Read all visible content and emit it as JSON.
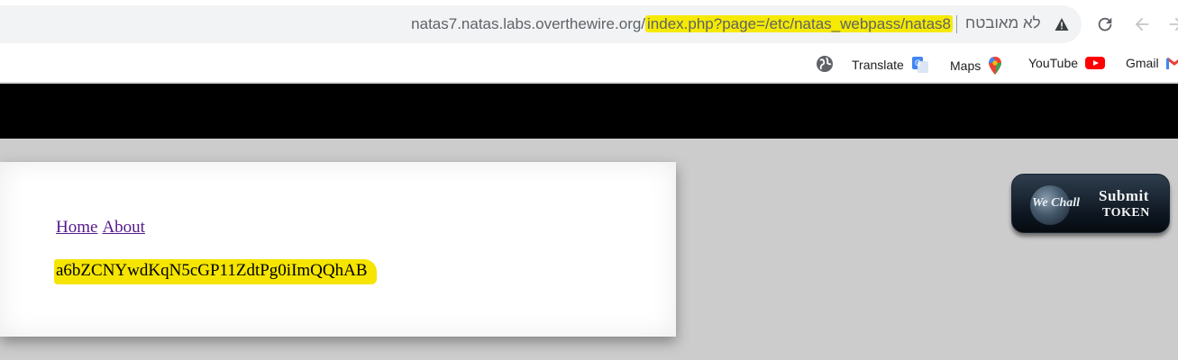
{
  "browser": {
    "url_host": "natas7.natas.labs.overthewire.org/",
    "url_path": "index.php?page=/etc/natas_webpass/natas8",
    "security_label": "לא מאובטח",
    "bookmarks": [
      {
        "label": "Gmail",
        "icon": "gmail-icon"
      },
      {
        "label": "YouTube",
        "icon": "youtube-icon"
      },
      {
        "label": "Maps",
        "icon": "maps-icon"
      },
      {
        "label": "Translate",
        "icon": "translate-icon"
      }
    ]
  },
  "page": {
    "nav": {
      "home": "Home",
      "about": "About"
    },
    "secret": "a6bZCNYwdKqN5cGP11ZdtPg0iImQQhAB"
  },
  "badge": {
    "brand": "We Chall",
    "submit": "Submit",
    "token": "TOKEN"
  },
  "colors": {
    "highlight": "#f5ea00",
    "header_band": "#000000",
    "page_bg": "#cccccc",
    "link": "#551a8b"
  }
}
